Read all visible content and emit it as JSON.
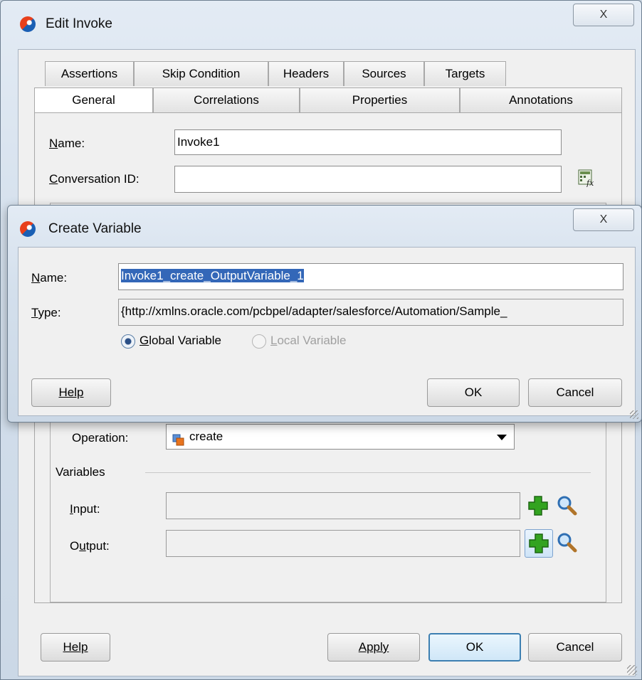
{
  "edit_invoke": {
    "title": "Edit Invoke",
    "close_label": "X",
    "tabs_row1": [
      "Assertions",
      "Skip Condition",
      "Headers",
      "Sources",
      "Targets"
    ],
    "tabs_row2": [
      "General",
      "Correlations",
      "Properties",
      "Annotations"
    ],
    "active_tab": "General",
    "name_label": "Name:",
    "name_value": "Invoke1",
    "conversation_label": "Conversation ID:",
    "conversation_value": "",
    "operation_label": "Operation:",
    "operation_value": "create",
    "variables_label": "Variables",
    "input_label": "Input:",
    "input_value": "",
    "output_label": "Output:",
    "output_value": "",
    "help_label": "Help",
    "apply_label": "Apply",
    "ok_label": "OK",
    "cancel_label": "Cancel"
  },
  "create_variable": {
    "title": "Create Variable",
    "close_label": "X",
    "name_label": "Name:",
    "name_value": "Invoke1_create_OutputVariable_1",
    "type_label": "Type:",
    "type_value": "{http://xmlns.oracle.com/pcbpel/adapter/salesforce/Automation/Sample_",
    "global_label": "Global Variable",
    "local_label": "Local Variable",
    "global_selected": true,
    "help_label": "Help",
    "ok_label": "OK",
    "cancel_label": "Cancel"
  },
  "icons": {
    "expression": "expression-builder-icon",
    "add": "add-plus-icon",
    "browse": "magnifier-icon",
    "operation": "operation-icon",
    "logo": "oracle-logo-icon",
    "colors": {
      "plus": "#2f9a1e",
      "selection": "#3367b8",
      "focus": "#3c7fb1"
    }
  }
}
